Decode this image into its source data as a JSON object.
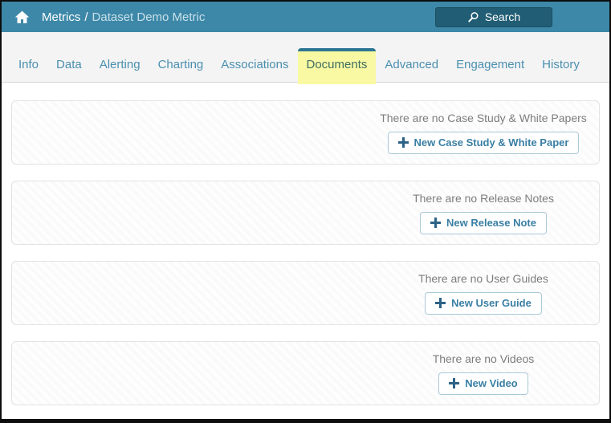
{
  "header": {
    "breadcrumb": {
      "section": "Metrics",
      "separator": "/",
      "current": "Dataset Demo Metric"
    },
    "search": {
      "label": "Search"
    }
  },
  "tabs": {
    "items": [
      {
        "label": "Info",
        "active": false
      },
      {
        "label": "Data",
        "active": false
      },
      {
        "label": "Alerting",
        "active": false
      },
      {
        "label": "Charting",
        "active": false
      },
      {
        "label": "Associations",
        "active": false
      },
      {
        "label": "Documents",
        "active": true
      },
      {
        "label": "Advanced",
        "active": false
      },
      {
        "label": "Engagement",
        "active": false
      },
      {
        "label": "History",
        "active": false
      }
    ]
  },
  "document_sections": [
    {
      "key": "case-study-white-paper",
      "empty_message": "There are no Case Study & White Papers",
      "new_button_label": "New Case Study & White Paper"
    },
    {
      "key": "release-note",
      "empty_message": "There are no Release Notes",
      "new_button_label": "New Release Note"
    },
    {
      "key": "user-guide",
      "empty_message": "There are no User Guides",
      "new_button_label": "New User Guide"
    },
    {
      "key": "video",
      "empty_message": "There are no Videos",
      "new_button_label": "New Video"
    }
  ],
  "icons": {
    "home": "home-icon",
    "search": "magnifier-icon",
    "plus": "plus-icon"
  },
  "colors": {
    "header_bar": "#3d88a8",
    "search_button": "#215d74",
    "tab_strip_background": "#f4f4f4",
    "active_tab_highlight": "#f9f9a3",
    "active_tab_top_border": "#2d7593",
    "tab_link_text": "#4a8fb0",
    "active_tab_text": "#3f6e60",
    "empty_message_text": "#7d7d7d",
    "new_button_text": "#3a7fa4",
    "new_button_border": "#abc8d7",
    "plus_icon": "#2d6287"
  }
}
